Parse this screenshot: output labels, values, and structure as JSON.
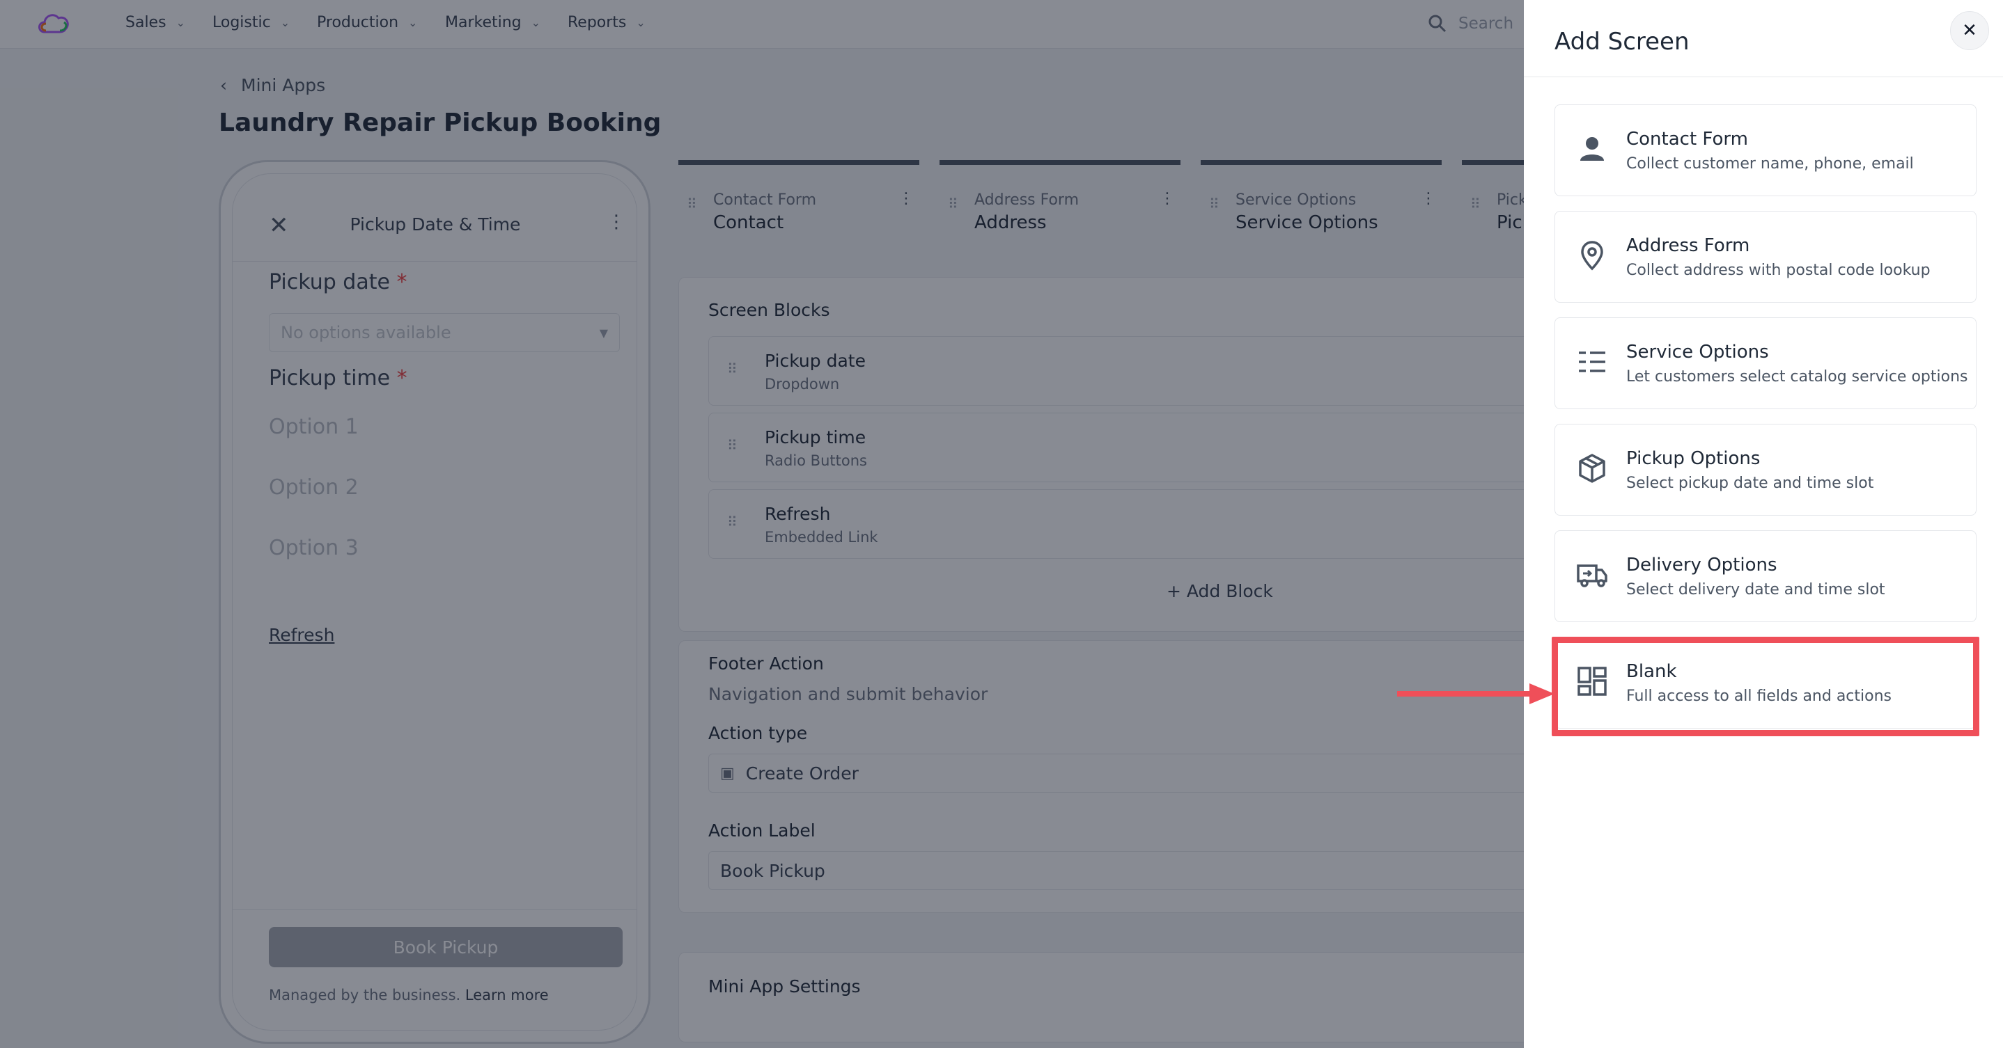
{
  "nav": {
    "items": [
      {
        "label": "Sales"
      },
      {
        "label": "Logistic"
      },
      {
        "label": "Production"
      },
      {
        "label": "Marketing"
      },
      {
        "label": "Reports"
      }
    ],
    "search_placeholder": "Search"
  },
  "breadcrumb": {
    "back_label": "Mini Apps"
  },
  "page": {
    "title": "Laundry Repair Pickup Booking"
  },
  "phone": {
    "title": "Pickup Date & Time",
    "pickup_date_label": "Pickup date",
    "required_mark": "*",
    "select_placeholder": "No options available",
    "pickup_time_label": "Pickup time",
    "options": [
      "Option 1",
      "Option 2",
      "Option 3"
    ],
    "refresh_link": "Refresh",
    "book_button": "Book Pickup",
    "managed_text": "Managed by the business.",
    "learn_more": "Learn more"
  },
  "tabs": [
    {
      "sub": "Contact Form",
      "main": "Contact"
    },
    {
      "sub": "Address Form",
      "main": "Address"
    },
    {
      "sub": "Service Options",
      "main": "Service Options"
    },
    {
      "sub": "Pick",
      "main": "Pick"
    }
  ],
  "screen_blocks": {
    "title": "Screen Blocks",
    "blocks": [
      {
        "name": "Pickup date",
        "type": "Dropdown"
      },
      {
        "name": "Pickup time",
        "type": "Radio Buttons"
      },
      {
        "name": "Refresh",
        "type": "Embedded Link"
      }
    ],
    "add_block": "+  Add Block"
  },
  "footer_action": {
    "title": "Footer Action",
    "subtitle": "Navigation and submit behavior",
    "action_type_label": "Action type",
    "action_type_value": "Create Order",
    "action_label_label": "Action Label",
    "action_label_value": "Book Pickup"
  },
  "settings": {
    "title": "Mini App Settings"
  },
  "drawer": {
    "title": "Add Screen",
    "close_glyph": "✕",
    "options": [
      {
        "title": "Contact Form",
        "desc": "Collect customer name, phone, email",
        "icon": "person-icon"
      },
      {
        "title": "Address Form",
        "desc": "Collect address with postal code lookup",
        "icon": "location-pin-icon"
      },
      {
        "title": "Service Options",
        "desc": "Let customers select catalog service options",
        "icon": "list-icon"
      },
      {
        "title": "Pickup Options",
        "desc": "Select pickup date and time slot",
        "icon": "package-icon"
      },
      {
        "title": "Delivery Options",
        "desc": "Select delivery date and time slot",
        "icon": "truck-icon"
      },
      {
        "title": "Blank",
        "desc": "Full access to all fields and actions",
        "icon": "dashboard-grid-icon"
      }
    ]
  },
  "colors": {
    "highlight": "#ef4f59",
    "overlay": "rgba(17,24,39,0.5)",
    "text_primary": "#1f2937"
  }
}
